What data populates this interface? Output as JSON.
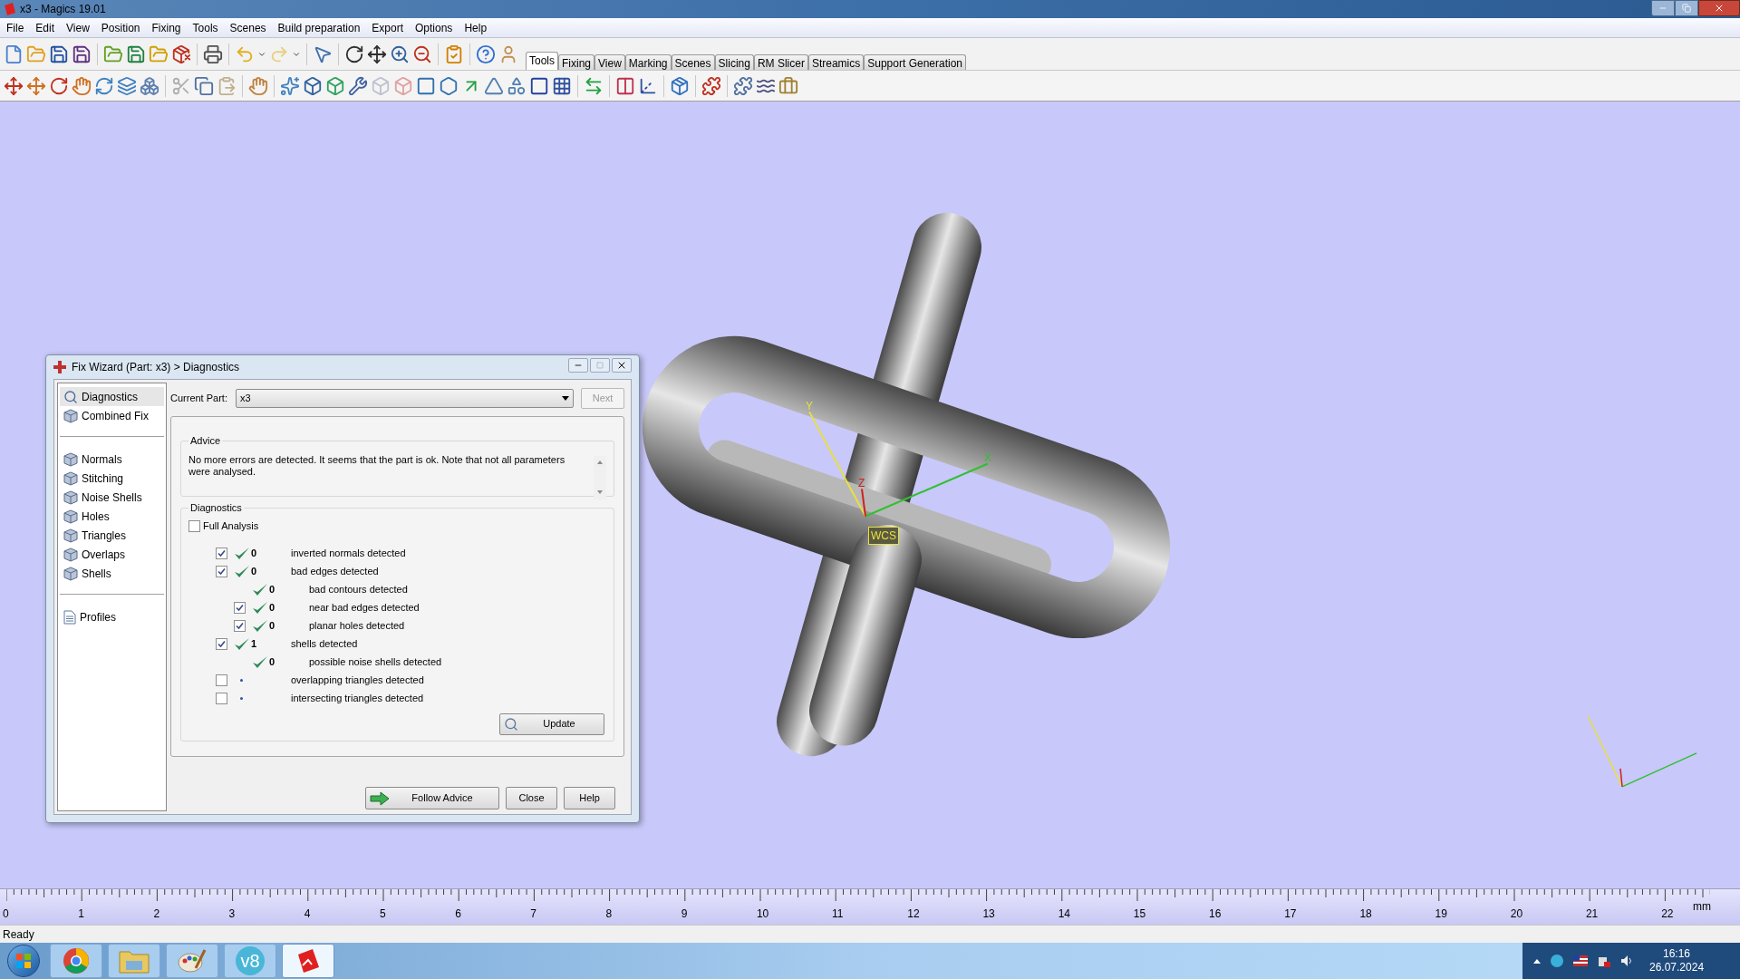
{
  "window": {
    "title": "x3 - Magics 19.01"
  },
  "menu": [
    "File",
    "Edit",
    "View",
    "Position",
    "Fixing",
    "Tools",
    "Scenes",
    "Build preparation",
    "Export",
    "Options",
    "Help"
  ],
  "tabs": [
    {
      "label": "Tools",
      "selected": true
    },
    {
      "label": "Fixing",
      "selected": false
    },
    {
      "label": "View",
      "selected": false
    },
    {
      "label": "Marking",
      "selected": false
    },
    {
      "label": "Scenes",
      "selected": false
    },
    {
      "label": "Slicing",
      "selected": false
    },
    {
      "label": "RM Slicer",
      "selected": false
    },
    {
      "label": "Streamics",
      "selected": false
    },
    {
      "label": "Support Generation",
      "selected": false
    }
  ],
  "viewport": {
    "wcs": {
      "label": "WCS",
      "axes": [
        {
          "label": "Y",
          "color": "#e8e040"
        },
        {
          "label": "X",
          "color": "#30c030"
        },
        {
          "label": "Z",
          "color": "#d02020"
        }
      ]
    }
  },
  "dialog": {
    "title": "Fix Wizard (Part: x3) > Diagnostics",
    "nav": [
      {
        "items": [
          {
            "label": "Diagnostics",
            "kind": "search",
            "selected": true
          },
          {
            "label": "Combined Fix",
            "kind": "cube",
            "selected": false
          }
        ]
      },
      {
        "items": [
          {
            "label": "Normals",
            "kind": "cube",
            "selected": false
          },
          {
            "label": "Stitching",
            "kind": "cube",
            "selected": false
          },
          {
            "label": "Noise Shells",
            "kind": "cube",
            "selected": false
          },
          {
            "label": "Holes",
            "kind": "cube",
            "selected": false
          },
          {
            "label": "Triangles",
            "kind": "cube",
            "selected": false
          },
          {
            "label": "Overlaps",
            "kind": "cube",
            "selected": false
          },
          {
            "label": "Shells",
            "kind": "cube",
            "selected": false
          }
        ]
      },
      {
        "items": [
          {
            "label": "Profiles",
            "kind": "document",
            "selected": false
          }
        ]
      }
    ],
    "current_part": {
      "label": "Current Part:",
      "value": "x3"
    },
    "next_button": {
      "label": "Next",
      "disabled": true
    },
    "advice": {
      "title": "Advice",
      "text": "No more errors are detected. It seems that the part is ok. Note that not all parameters were analysed."
    },
    "diagnostics": {
      "title": "Diagnostics",
      "full_analysis": {
        "label": "Full Analysis",
        "checked": false
      },
      "rows": [
        {
          "kind": "check",
          "checked": true,
          "passed": true,
          "count": "0",
          "label": "inverted normals detected"
        },
        {
          "kind": "check",
          "checked": true,
          "passed": true,
          "count": "0",
          "label": "bad edges detected",
          "children": [
            {
              "kind": "info",
              "passed": true,
              "count": "0",
              "label": "bad contours detected"
            },
            {
              "kind": "check",
              "checked": true,
              "passed": true,
              "count": "0",
              "label": "near bad edges detected"
            },
            {
              "kind": "check",
              "checked": true,
              "passed": true,
              "count": "0",
              "label": "planar holes detected"
            }
          ]
        },
        {
          "kind": "check",
          "checked": true,
          "passed": true,
          "count": "1",
          "label": "shells detected",
          "children": [
            {
              "kind": "info",
              "passed": true,
              "count": "0",
              "label": "possible noise shells detected"
            }
          ]
        },
        {
          "kind": "check",
          "checked": false,
          "passed": false,
          "label": "overlapping triangles detected"
        },
        {
          "kind": "check",
          "checked": false,
          "passed": false,
          "label": "intersecting triangles detected"
        }
      ]
    },
    "update_button": "Update",
    "buttons": [
      {
        "label": "Follow Advice",
        "kind": "follow"
      },
      {
        "label": "Close",
        "kind": "plain"
      },
      {
        "label": "Help",
        "kind": "plain"
      }
    ]
  },
  "ruler": {
    "labels": [
      "0",
      "1",
      "2",
      "3",
      "4",
      "5",
      "6",
      "7",
      "8",
      "9",
      "10",
      "11",
      "12",
      "13",
      "14",
      "15",
      "16",
      "17",
      "18",
      "19",
      "20",
      "21",
      "22"
    ],
    "unit": "mm"
  },
  "status_bar": "Ready",
  "taskbar": {
    "apps": [
      {
        "kind": "browser",
        "selected": false
      },
      {
        "kind": "folder",
        "selected": false
      },
      {
        "kind": "paint",
        "selected": false
      },
      {
        "kind": "logo",
        "label": "v8",
        "selected": false
      },
      {
        "kind": "magics",
        "selected": true
      }
    ],
    "time": "16:16",
    "date": "26.07.2024"
  }
}
